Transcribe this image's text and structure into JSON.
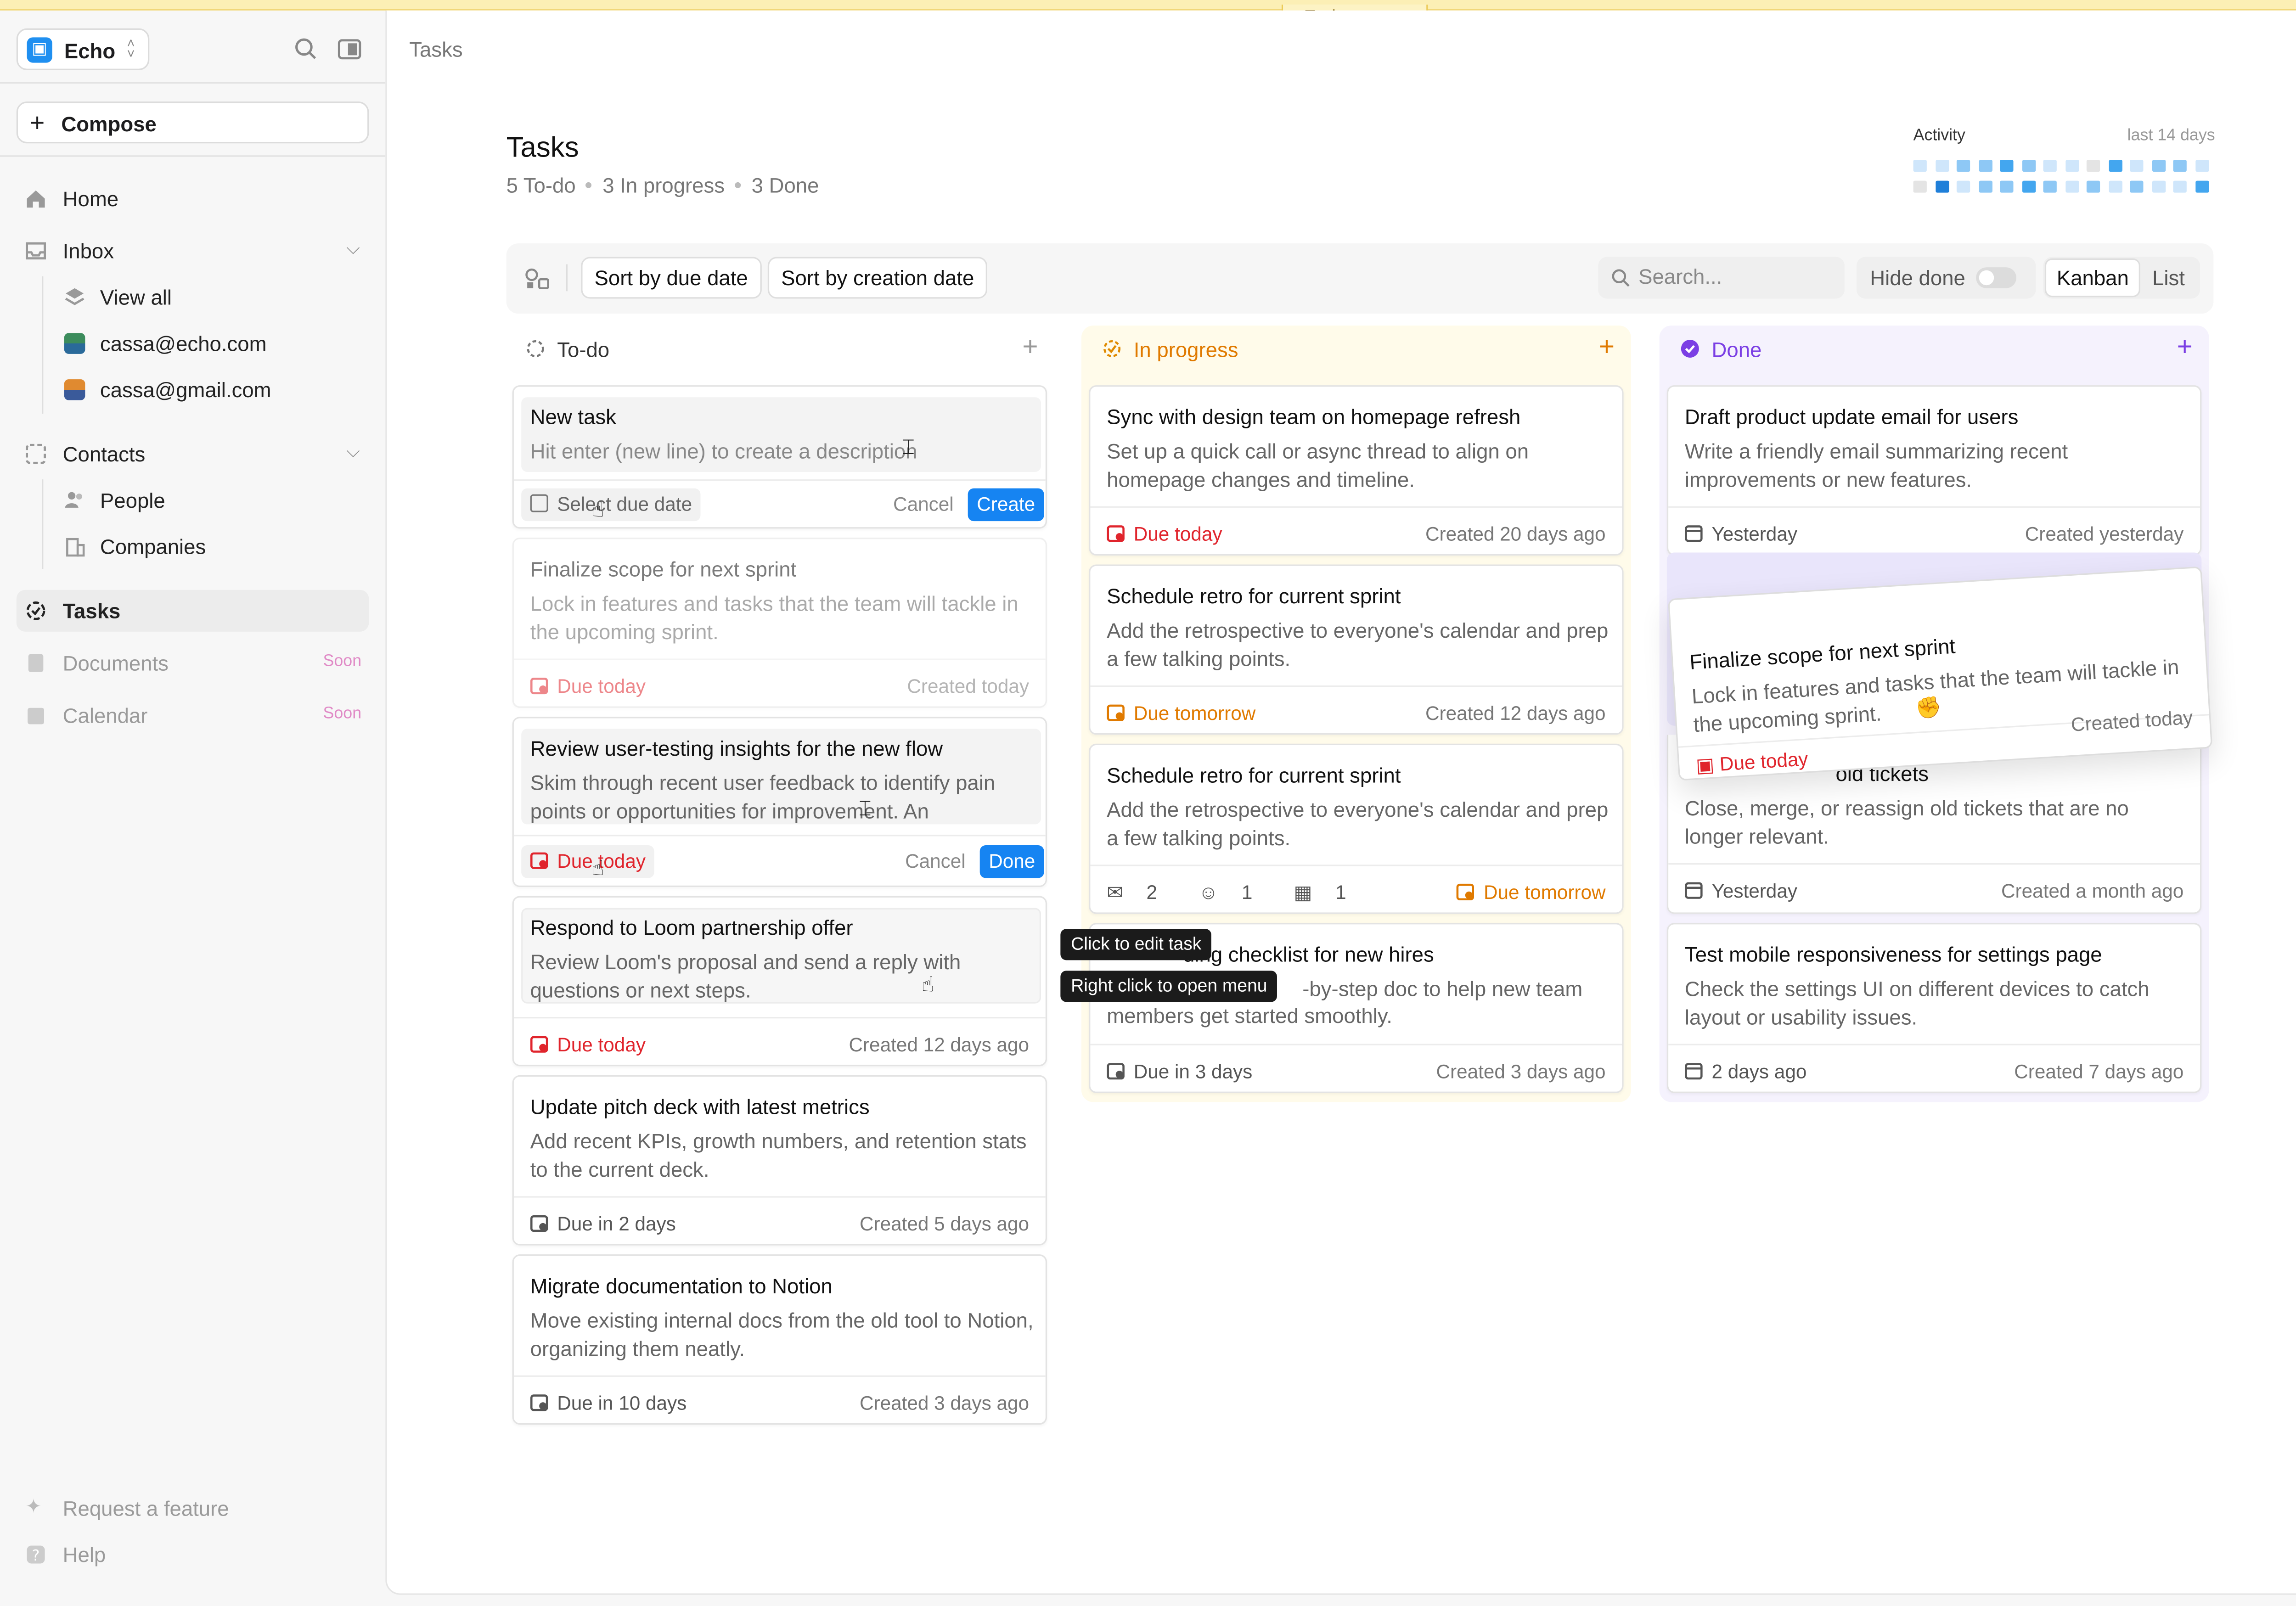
{
  "banner": {
    "label": "Early access"
  },
  "sidebar": {
    "workspace": "Echo",
    "compose": "Compose",
    "items": {
      "home": "Home",
      "inbox": "Inbox",
      "view_all": "View all",
      "account1": "cassa@echo.com",
      "account2": "cassa@gmail.com",
      "contacts": "Contacts",
      "people": "People",
      "companies": "Companies",
      "tasks": "Tasks",
      "documents": "Documents",
      "calendar": "Calendar",
      "soon": "Soon",
      "request_feature": "Request a feature",
      "help": "Help"
    }
  },
  "main": {
    "breadcrumb": "Tasks",
    "title": "Tasks",
    "counts": {
      "todo": "5 To-do",
      "in_progress": "3 In progress",
      "done": "3 Done"
    },
    "activity": {
      "title": "Activity",
      "range": "last 14 days",
      "levels": [
        1,
        1,
        2,
        2,
        3,
        2,
        1,
        1,
        0,
        3,
        1,
        2,
        2,
        1,
        0,
        4,
        1,
        2,
        2,
        3,
        2,
        1,
        2,
        1,
        2,
        1,
        1,
        3,
        4
      ]
    },
    "toolbar": {
      "sort_due": "Sort by due date",
      "sort_created": "Sort by creation date",
      "search_placeholder": "Search...",
      "hide_done": "Hide done",
      "hide_done_on": false,
      "view_kanban": "Kanban",
      "view_list": "List",
      "active_view": "Kanban"
    }
  },
  "columns": {
    "todo": {
      "title": "To-do",
      "new_task": {
        "title": "New task",
        "placeholder": "Hit enter (new line) to create a description",
        "due_chip": "Select due date",
        "cancel": "Cancel",
        "create": "Create"
      },
      "cards": [
        {
          "title": "Finalize scope for next sprint",
          "desc": "Lock in features and tasks that the team will tackle in the upcoming sprint.",
          "due": "Due today",
          "created": "Created today"
        },
        {
          "title": "Review user-testing insights for the new flow",
          "desc": "Skim through recent user feedback to identify pain points or opportunities for improvement. An",
          "due": "Due today",
          "cancel": "Cancel",
          "done": "Done"
        },
        {
          "title": "Respond to Loom partnership offer",
          "desc": "Review Loom's proposal and send a reply with questions or next steps.",
          "due": "Due today",
          "created": "Created 12 days ago"
        },
        {
          "title": "Update pitch deck with latest metrics",
          "desc": "Add recent KPIs, growth numbers, and retention stats to the current deck.",
          "due": "Due in 2 days",
          "created": "Created 5 days ago"
        },
        {
          "title": "Migrate documentation to Notion",
          "desc": "Move existing internal docs from the old tool to Notion, organizing them neatly.",
          "due": "Due in 10 days",
          "created": "Created 3 days ago"
        }
      ]
    },
    "in_progress": {
      "title": "In progress",
      "cards": [
        {
          "title": "Sync with design team on homepage refresh",
          "desc": "Set up a quick call or async thread to align on homepage changes and timeline.",
          "due": "Due today",
          "created": "Created 20 days ago"
        },
        {
          "title": "Schedule retro for current sprint",
          "desc": "Add the retrospective to everyone's calendar and prep a few talking points.",
          "due": "Due tomorrow",
          "created": "Created 12 days ago"
        },
        {
          "title": "Schedule retro for current sprint",
          "desc": "Add the retrospective to everyone's calendar and prep a few talking points.",
          "due": "Due tomorrow",
          "meta": {
            "emails": "2",
            "people": "1",
            "companies": "1"
          }
        },
        {
          "title": "ding checklist for new hires",
          "desc": "-by-step doc to help new team",
          "desc2": "members get started smoothly.",
          "due": "Due in 3 days",
          "created": "Created 3 days ago"
        }
      ]
    },
    "done": {
      "title": "Done",
      "cards": [
        {
          "title": "Draft product update email for users",
          "desc": "Write a friendly email summarizing recent improvements or new features.",
          "due": "Yesterday",
          "created": "Created yesterday"
        },
        {
          "title": "old tickets",
          "desc": "Close, merge, or reassign old tickets that are no longer relevant.",
          "due": "Yesterday",
          "created": "Created a month ago"
        },
        {
          "title": "Test mobile responsiveness for settings page",
          "desc": "Check the settings UI on different devices to catch layout or usability issues.",
          "due": "2 days ago",
          "created": "Created 7 days ago"
        }
      ]
    }
  },
  "dragging": {
    "title": "Finalize scope for next sprint",
    "desc": "Lock in features and tasks that the team will tackle in the upcoming sprint.",
    "due": "Due today",
    "created": "Created today"
  },
  "tooltips": {
    "edit": "Click to edit task",
    "menu": "Right click to open menu"
  },
  "colors": {
    "accent": "#1684f2",
    "red": "#e0242c",
    "orange": "#e07a00",
    "purple": "#7b3fe4"
  }
}
